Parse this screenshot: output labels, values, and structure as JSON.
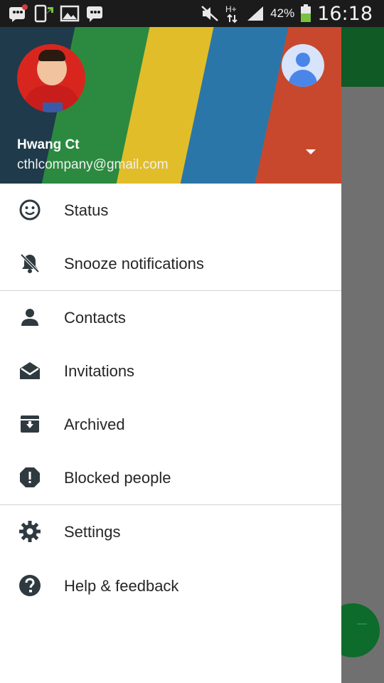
{
  "status_bar": {
    "battery_percent": "42%",
    "time": "16:18",
    "network": "H+",
    "icons": [
      "bbm-notification-icon",
      "phone-transfer-icon",
      "image-icon",
      "bbm-icon",
      "mute-icon",
      "signal-icon",
      "battery-icon"
    ]
  },
  "account": {
    "name": "Hwang Ct",
    "email": "cthlcompany@gmail.com"
  },
  "menu": {
    "items": [
      {
        "label": "Status",
        "icon": "emoji-icon"
      },
      {
        "label": "Snooze notifications",
        "icon": "bell-off-icon"
      },
      {
        "label": "Contacts",
        "icon": "person-icon"
      },
      {
        "label": "Invitations",
        "icon": "envelope-open-icon"
      },
      {
        "label": "Archived",
        "icon": "archive-icon"
      },
      {
        "label": "Blocked people",
        "icon": "block-alert-icon"
      },
      {
        "label": "Settings",
        "icon": "gear-icon"
      },
      {
        "label": "Help & feedback",
        "icon": "help-icon"
      }
    ]
  },
  "colors": {
    "accent_green": "#0f5a25",
    "icon_dark": "#2f3a40",
    "text": "#262626"
  }
}
